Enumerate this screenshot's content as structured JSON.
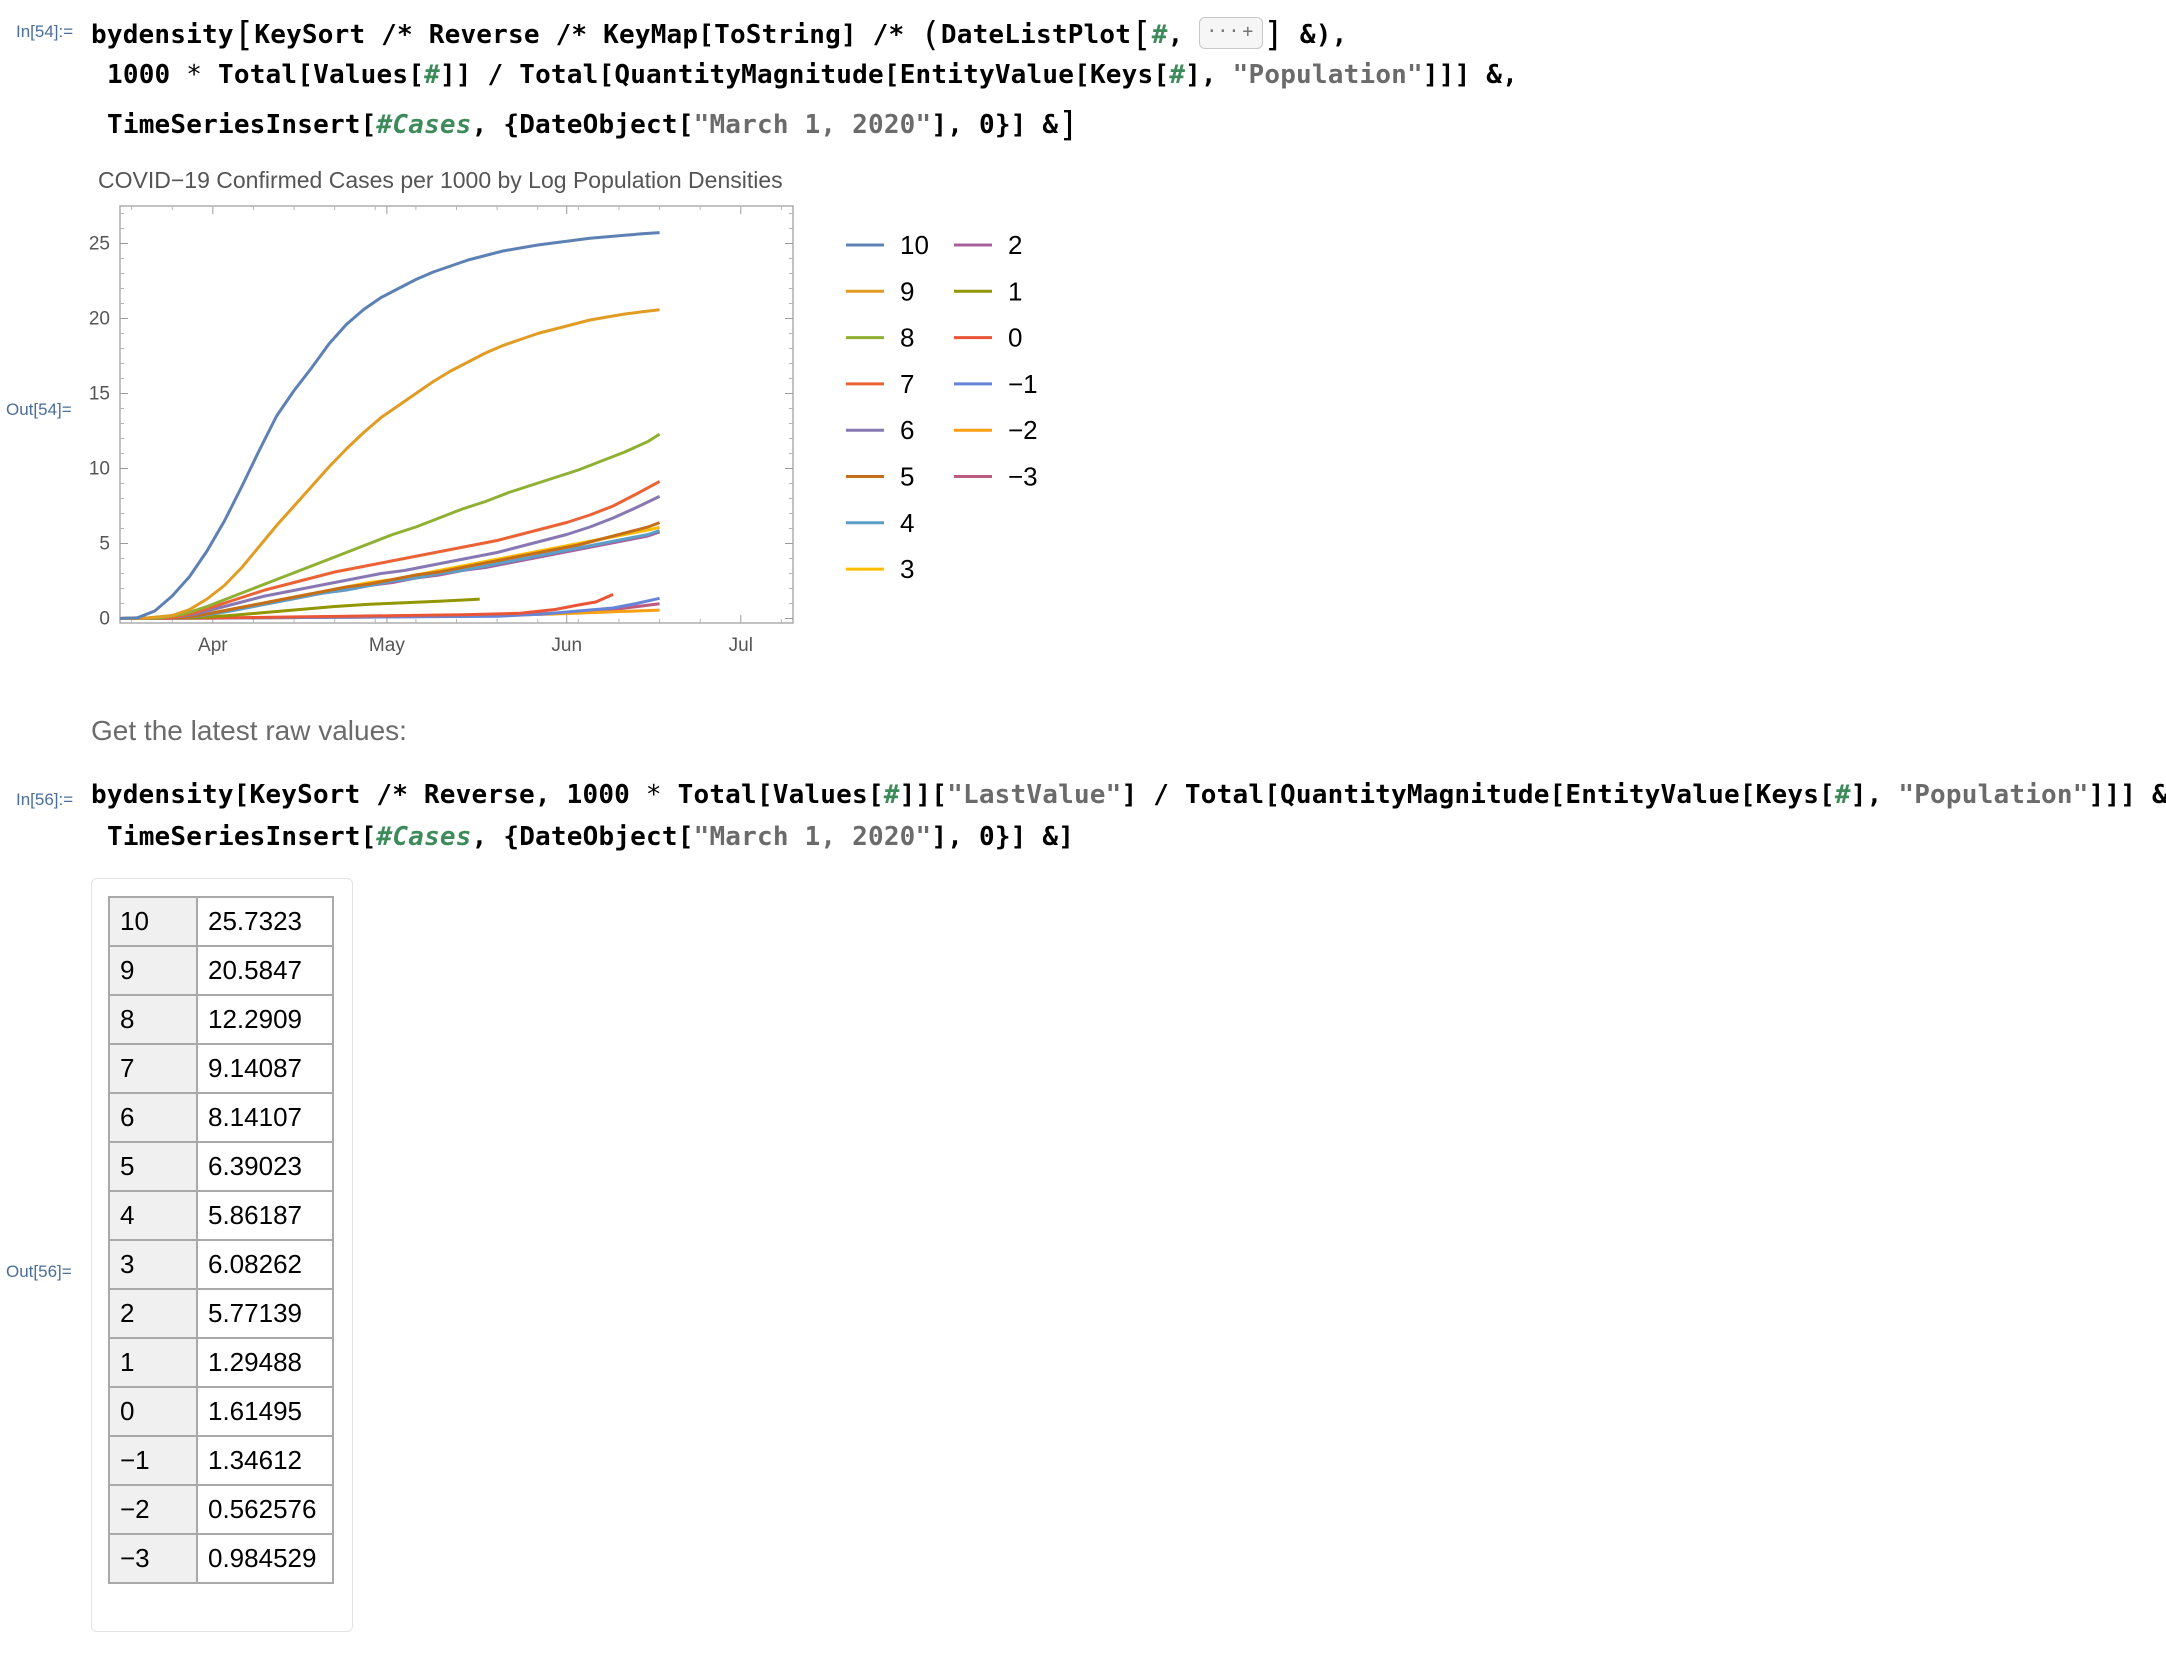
{
  "in54": {
    "label": "In[54]:=",
    "line1": {
      "a": "bydensity",
      "b": "KeySort /* Reverse /* KeyMap[ToString] /* ",
      "c": "DateListPlot",
      "d": "#",
      "e": "&)",
      "elide_dots": "···",
      "elide_plus": "+"
    },
    "line2": {
      "a": "1000",
      "b": "Total[Values[",
      "c": "#",
      "d": "]] / Total[QuantityMagnitude[EntityValue[Keys[",
      "e": "#",
      "f": "], ",
      "g": "\"Population\"",
      "h": "]]] &,"
    },
    "line3": {
      "a": "TimeSeriesInsert[",
      "b": "#Cases",
      "c": ", {DateObject[",
      "d": "\"March 1, 2020\"",
      "e": "], 0}] &"
    }
  },
  "out54": {
    "label": "Out[54]="
  },
  "text_cell": "Get the latest raw values:",
  "in56": {
    "label": "In[56]:=",
    "line1": {
      "a": "bydensity[KeySort /* Reverse, ",
      "b": "1000",
      "c": "Total[Values[",
      "d": "#",
      "e": "]][",
      "f": "\"LastValue\"",
      "g": "] / Total[QuantityMagnitude[EntityValue[Keys[",
      "h": "#",
      "i": "], ",
      "j": "\"Population\"",
      "k": "]]] &,"
    },
    "line2": {
      "a": "TimeSeriesInsert[",
      "b": "#Cases",
      "c": ", {DateObject[",
      "d": "\"March 1, 2020\"",
      "e": "], 0}] &]"
    }
  },
  "out56": {
    "label": "Out[56]="
  },
  "table": {
    "rows": [
      {
        "k": "10",
        "v": "25.7323"
      },
      {
        "k": "9",
        "v": "20.5847"
      },
      {
        "k": "8",
        "v": "12.2909"
      },
      {
        "k": "7",
        "v": "9.14087"
      },
      {
        "k": "6",
        "v": "8.14107"
      },
      {
        "k": "5",
        "v": "6.39023"
      },
      {
        "k": "4",
        "v": "5.86187"
      },
      {
        "k": "3",
        "v": "6.08262"
      },
      {
        "k": "2",
        "v": "5.77139"
      },
      {
        "k": "1",
        "v": "1.29488"
      },
      {
        "k": "0",
        "v": "1.61495"
      },
      {
        "k": "−1",
        "v": "1.34612"
      },
      {
        "k": "−2",
        "v": "0.562576"
      },
      {
        "k": "−3",
        "v": "0.984529"
      }
    ]
  },
  "chart_data": {
    "type": "line",
    "title": "COVID−19 Confirmed Cases per 1000 by Log Population Densities",
    "xlabel": "",
    "ylabel": "",
    "x_ticks": [
      {
        "label": "Apr",
        "day": 31
      },
      {
        "label": "May",
        "day": 61
      },
      {
        "label": "Jun",
        "day": 92
      },
      {
        "label": "Jul",
        "day": 122
      }
    ],
    "y_ticks": [
      0,
      5,
      10,
      15,
      20,
      25
    ],
    "xlim_days": [
      15,
      131
    ],
    "ylim": [
      -0.3,
      27.5
    ],
    "grid": false,
    "legend_placement": "right",
    "series": [
      {
        "name": "10",
        "color": "#5e81b5",
        "points": [
          [
            15,
            0
          ],
          [
            18,
            0.05
          ],
          [
            21,
            0.5
          ],
          [
            24,
            1.5
          ],
          [
            27,
            2.8
          ],
          [
            30,
            4.5
          ],
          [
            33,
            6.5
          ],
          [
            36,
            8.8
          ],
          [
            39,
            11.2
          ],
          [
            42,
            13.5
          ],
          [
            45,
            15.2
          ],
          [
            48,
            16.7
          ],
          [
            51,
            18.3
          ],
          [
            54,
            19.6
          ],
          [
            57,
            20.6
          ],
          [
            60,
            21.4
          ],
          [
            63,
            22
          ],
          [
            66,
            22.6
          ],
          [
            69,
            23.1
          ],
          [
            72,
            23.5
          ],
          [
            75,
            23.9
          ],
          [
            78,
            24.2
          ],
          [
            81,
            24.5
          ],
          [
            84,
            24.7
          ],
          [
            87,
            24.9
          ],
          [
            90,
            25.05
          ],
          [
            93,
            25.2
          ],
          [
            96,
            25.35
          ],
          [
            99,
            25.45
          ],
          [
            102,
            25.55
          ],
          [
            105,
            25.65
          ],
          [
            108,
            25.73
          ]
        ]
      },
      {
        "name": "9",
        "color": "#e19c24",
        "points": [
          [
            15,
            0
          ],
          [
            20,
            0.05
          ],
          [
            24,
            0.2
          ],
          [
            27,
            0.6
          ],
          [
            30,
            1.3
          ],
          [
            33,
            2.2
          ],
          [
            36,
            3.4
          ],
          [
            39,
            4.8
          ],
          [
            42,
            6.2
          ],
          [
            45,
            7.5
          ],
          [
            48,
            8.8
          ],
          [
            51,
            10.1
          ],
          [
            54,
            11.3
          ],
          [
            57,
            12.4
          ],
          [
            60,
            13.4
          ],
          [
            63,
            14.2
          ],
          [
            66,
            15
          ],
          [
            69,
            15.8
          ],
          [
            72,
            16.5
          ],
          [
            75,
            17.1
          ],
          [
            78,
            17.7
          ],
          [
            81,
            18.2
          ],
          [
            84,
            18.6
          ],
          [
            87,
            19
          ],
          [
            90,
            19.3
          ],
          [
            93,
            19.6
          ],
          [
            96,
            19.9
          ],
          [
            99,
            20.1
          ],
          [
            102,
            20.3
          ],
          [
            105,
            20.45
          ],
          [
            108,
            20.58
          ]
        ]
      },
      {
        "name": "8",
        "color": "#8fb032",
        "points": [
          [
            15,
            0
          ],
          [
            22,
            0.05
          ],
          [
            26,
            0.3
          ],
          [
            30,
            0.8
          ],
          [
            34,
            1.4
          ],
          [
            38,
            2
          ],
          [
            42,
            2.6
          ],
          [
            46,
            3.2
          ],
          [
            50,
            3.8
          ],
          [
            54,
            4.4
          ],
          [
            58,
            5
          ],
          [
            62,
            5.6
          ],
          [
            66,
            6.1
          ],
          [
            70,
            6.7
          ],
          [
            74,
            7.3
          ],
          [
            78,
            7.8
          ],
          [
            82,
            8.4
          ],
          [
            86,
            8.9
          ],
          [
            90,
            9.4
          ],
          [
            94,
            9.9
          ],
          [
            98,
            10.5
          ],
          [
            102,
            11.1
          ],
          [
            106,
            11.8
          ],
          [
            108,
            12.29
          ]
        ]
      },
      {
        "name": "7",
        "color": "#eb6235",
        "points": [
          [
            15,
            0
          ],
          [
            24,
            0.05
          ],
          [
            28,
            0.4
          ],
          [
            32,
            0.9
          ],
          [
            36,
            1.4
          ],
          [
            40,
            1.9
          ],
          [
            44,
            2.3
          ],
          [
            48,
            2.7
          ],
          [
            52,
            3.1
          ],
          [
            56,
            3.4
          ],
          [
            60,
            3.7
          ],
          [
            64,
            4
          ],
          [
            68,
            4.3
          ],
          [
            72,
            4.6
          ],
          [
            76,
            4.9
          ],
          [
            80,
            5.2
          ],
          [
            84,
            5.6
          ],
          [
            88,
            6
          ],
          [
            92,
            6.4
          ],
          [
            96,
            6.9
          ],
          [
            100,
            7.5
          ],
          [
            104,
            8.3
          ],
          [
            108,
            9.14
          ]
        ]
      },
      {
        "name": "6",
        "color": "#8778b3",
        "points": [
          [
            15,
            0
          ],
          [
            24,
            0.05
          ],
          [
            28,
            0.3
          ],
          [
            32,
            0.7
          ],
          [
            36,
            1.1
          ],
          [
            40,
            1.5
          ],
          [
            44,
            1.8
          ],
          [
            48,
            2.1
          ],
          [
            52,
            2.4
          ],
          [
            56,
            2.7
          ],
          [
            60,
            3
          ],
          [
            64,
            3.2
          ],
          [
            68,
            3.5
          ],
          [
            72,
            3.8
          ],
          [
            76,
            4.1
          ],
          [
            80,
            4.4
          ],
          [
            84,
            4.8
          ],
          [
            88,
            5.2
          ],
          [
            92,
            5.6
          ],
          [
            96,
            6.1
          ],
          [
            100,
            6.7
          ],
          [
            104,
            7.4
          ],
          [
            108,
            8.14
          ]
        ]
      },
      {
        "name": "5",
        "color": "#c56e1a",
        "points": [
          [
            15,
            0
          ],
          [
            26,
            0.05
          ],
          [
            30,
            0.3
          ],
          [
            34,
            0.6
          ],
          [
            38,
            0.9
          ],
          [
            42,
            1.2
          ],
          [
            46,
            1.5
          ],
          [
            50,
            1.8
          ],
          [
            54,
            2.1
          ],
          [
            58,
            2.3
          ],
          [
            62,
            2.6
          ],
          [
            66,
            2.9
          ],
          [
            70,
            3.1
          ],
          [
            74,
            3.4
          ],
          [
            78,
            3.7
          ],
          [
            82,
            4
          ],
          [
            86,
            4.3
          ],
          [
            90,
            4.6
          ],
          [
            94,
            4.9
          ],
          [
            98,
            5.3
          ],
          [
            102,
            5.7
          ],
          [
            106,
            6.1
          ],
          [
            108,
            6.39
          ]
        ]
      },
      {
        "name": "4",
        "color": "#5d9ec7",
        "points": [
          [
            15,
            0
          ],
          [
            26,
            0.05
          ],
          [
            30,
            0.25
          ],
          [
            34,
            0.5
          ],
          [
            38,
            0.8
          ],
          [
            42,
            1.1
          ],
          [
            46,
            1.4
          ],
          [
            50,
            1.7
          ],
          [
            54,
            1.9
          ],
          [
            58,
            2.2
          ],
          [
            62,
            2.5
          ],
          [
            66,
            2.7
          ],
          [
            70,
            3
          ],
          [
            74,
            3.2
          ],
          [
            78,
            3.5
          ],
          [
            82,
            3.8
          ],
          [
            86,
            4.1
          ],
          [
            90,
            4.4
          ],
          [
            94,
            4.7
          ],
          [
            98,
            5
          ],
          [
            102,
            5.3
          ],
          [
            106,
            5.6
          ],
          [
            108,
            5.86
          ]
        ]
      },
      {
        "name": "3",
        "color": "#ffbf00",
        "points": [
          [
            15,
            0
          ],
          [
            26,
            0.05
          ],
          [
            30,
            0.3
          ],
          [
            34,
            0.6
          ],
          [
            38,
            0.9
          ],
          [
            42,
            1.2
          ],
          [
            46,
            1.5
          ],
          [
            50,
            1.8
          ],
          [
            54,
            2.1
          ],
          [
            58,
            2.4
          ],
          [
            62,
            2.6
          ],
          [
            66,
            2.9
          ],
          [
            70,
            3.2
          ],
          [
            74,
            3.5
          ],
          [
            78,
            3.8
          ],
          [
            82,
            4.1
          ],
          [
            86,
            4.4
          ],
          [
            90,
            4.7
          ],
          [
            94,
            5
          ],
          [
            98,
            5.3
          ],
          [
            102,
            5.6
          ],
          [
            106,
            5.9
          ],
          [
            108,
            6.08
          ]
        ]
      },
      {
        "name": "2",
        "color": "#a5609d",
        "points": [
          [
            15,
            0
          ],
          [
            26,
            0.05
          ],
          [
            30,
            0.25
          ],
          [
            34,
            0.5
          ],
          [
            38,
            0.8
          ],
          [
            42,
            1.1
          ],
          [
            46,
            1.4
          ],
          [
            50,
            1.7
          ],
          [
            54,
            1.9
          ],
          [
            58,
            2.2
          ],
          [
            62,
            2.4
          ],
          [
            66,
            2.7
          ],
          [
            70,
            2.9
          ],
          [
            74,
            3.2
          ],
          [
            78,
            3.4
          ],
          [
            82,
            3.7
          ],
          [
            86,
            4
          ],
          [
            90,
            4.3
          ],
          [
            94,
            4.6
          ],
          [
            98,
            4.9
          ],
          [
            102,
            5.2
          ],
          [
            106,
            5.5
          ],
          [
            108,
            5.77
          ]
        ]
      },
      {
        "name": "1",
        "color": "#929600",
        "points": [
          [
            15,
            0
          ],
          [
            28,
            0.05
          ],
          [
            34,
            0.2
          ],
          [
            40,
            0.4
          ],
          [
            46,
            0.6
          ],
          [
            52,
            0.8
          ],
          [
            58,
            0.95
          ],
          [
            64,
            1.05
          ],
          [
            70,
            1.15
          ],
          [
            75,
            1.25
          ],
          [
            77,
            1.29
          ]
        ]
      },
      {
        "name": "0",
        "color": "#e95536",
        "points": [
          [
            15,
            0
          ],
          [
            34,
            0.05
          ],
          [
            44,
            0.1
          ],
          [
            54,
            0.15
          ],
          [
            64,
            0.2
          ],
          [
            74,
            0.25
          ],
          [
            84,
            0.35
          ],
          [
            90,
            0.6
          ],
          [
            94,
            0.9
          ],
          [
            97,
            1.1
          ],
          [
            100,
            1.61
          ]
        ]
      },
      {
        "name": "−1",
        "color": "#6685d9",
        "points": [
          [
            15,
            0
          ],
          [
            40,
            0.05
          ],
          [
            60,
            0.1
          ],
          [
            80,
            0.15
          ],
          [
            88,
            0.3
          ],
          [
            94,
            0.5
          ],
          [
            100,
            0.7
          ],
          [
            104,
            1
          ],
          [
            108,
            1.35
          ]
        ]
      },
      {
        "name": "−2",
        "color": "#f89f13",
        "points": [
          [
            15,
            0
          ],
          [
            40,
            0.05
          ],
          [
            60,
            0.1
          ],
          [
            80,
            0.2
          ],
          [
            90,
            0.3
          ],
          [
            100,
            0.45
          ],
          [
            108,
            0.56
          ]
        ]
      },
      {
        "name": "−3",
        "color": "#bc5b80",
        "points": [
          [
            15,
            0
          ],
          [
            40,
            0.05
          ],
          [
            60,
            0.1
          ],
          [
            80,
            0.2
          ],
          [
            90,
            0.35
          ],
          [
            100,
            0.6
          ],
          [
            108,
            0.98
          ]
        ]
      }
    ]
  }
}
